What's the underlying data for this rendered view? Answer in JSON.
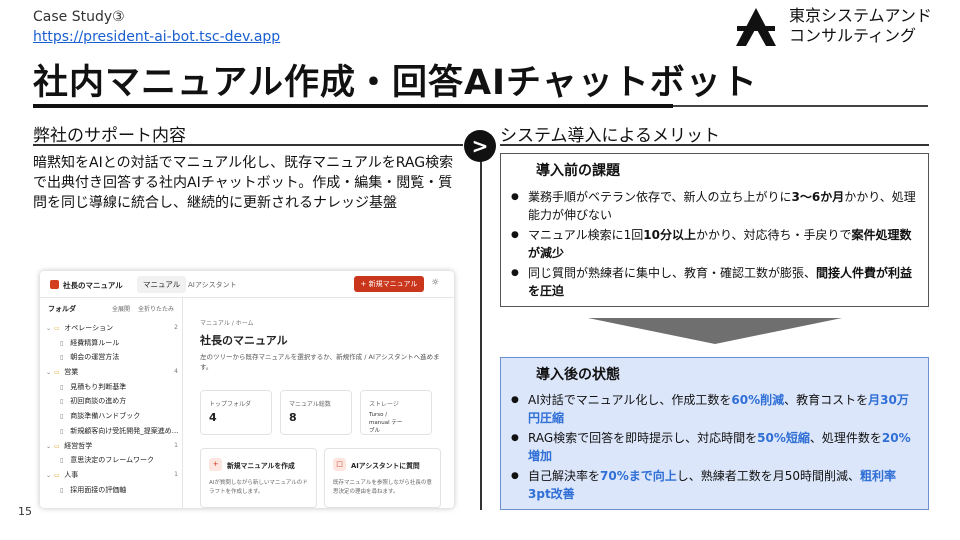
{
  "header": {
    "case_label": "Case Study③",
    "url": "https://president-ai-bot.tsc-dev.app",
    "company_line1": "東京システムアンド",
    "company_line2": "コンサルティング",
    "title": "社内マニュアル作成・回答AIチャットボット"
  },
  "left": {
    "heading": "弊社のサポート内容",
    "body": "暗黙知をAIとの対話でマニュアル化し、既存マニュアルをRAG検索で出典付き回答する社内AIチャットボット。作成・編集・閲覧・質問を同じ導線に統合し、継続的に更新されるナレッジ基盤"
  },
  "right": {
    "heading": "システム導入によるメリット",
    "arrow_glyph": ">",
    "before": {
      "title": "導入前の課題",
      "items": [
        [
          {
            "t": "業務手順がベテラン依存で、新人の立ち上がりに"
          },
          {
            "t": "3〜6か月",
            "s": "hl"
          },
          {
            "t": "かかり、処理能力が伸びない"
          }
        ],
        [
          {
            "t": "マニュアル検索に1回"
          },
          {
            "t": "10分以上",
            "s": "hl"
          },
          {
            "t": "かかり、対応待ち・手戻りで"
          },
          {
            "t": "案件処理数が減少",
            "s": "hl"
          }
        ],
        [
          {
            "t": "同じ質問が熟練者に集中し、教育・確認工数が膨張、"
          },
          {
            "t": "間接人件費が利益を圧迫",
            "s": "hl"
          }
        ]
      ]
    },
    "after": {
      "title": "導入後の状態",
      "items": [
        [
          {
            "t": "AI対話でマニュアル化し、作成工数を"
          },
          {
            "t": "60%削減",
            "s": "bl"
          },
          {
            "t": "、教育コストを"
          },
          {
            "t": "月30万円圧縮",
            "s": "bl"
          }
        ],
        [
          {
            "t": "RAG検索で回答を即時提示し、対応時間を"
          },
          {
            "t": "50%短縮",
            "s": "bl"
          },
          {
            "t": "、処理件数を"
          },
          {
            "t": "20%増加",
            "s": "bl"
          }
        ],
        [
          {
            "t": "自己解決率を"
          },
          {
            "t": "70%まで向上",
            "s": "bl"
          },
          {
            "t": "し、熟練者工数を月50時間削減、"
          },
          {
            "t": "粗利率3pt改善",
            "s": "bl"
          }
        ]
      ]
    }
  },
  "screenshot": {
    "app_name": "社長のマニュアル",
    "tab_manual": "マニュアル",
    "tab_ai": "AIアシスタント",
    "new_button": "+ 新規マニュアル",
    "sidebar_title": "フォルダ",
    "expand_all": "全展開",
    "collapse_all": "全折りたたみ",
    "tree": [
      {
        "type": "folder",
        "label": "オペレーション",
        "count": "2"
      },
      {
        "type": "doc",
        "label": "経費精算ルール"
      },
      {
        "type": "doc",
        "label": "朝会の運営方法"
      },
      {
        "type": "folder",
        "label": "営業",
        "count": "4"
      },
      {
        "type": "doc",
        "label": "見積もり判断基準"
      },
      {
        "type": "doc",
        "label": "初回商談の進め方"
      },
      {
        "type": "doc",
        "label": "商談準備ハンドブック"
      },
      {
        "type": "doc",
        "label": "新規顧客向け受託開発_提案進め..."
      },
      {
        "type": "folder",
        "label": "経営哲学",
        "count": "1"
      },
      {
        "type": "doc",
        "label": "意思決定のフレームワーク"
      },
      {
        "type": "folder",
        "label": "人事",
        "count": "1"
      },
      {
        "type": "doc",
        "label": "採用面接の評価軸"
      }
    ],
    "breadcrumb": "マニュアル / ホーム",
    "main_title": "社長のマニュアル",
    "main_desc": "左のツリーから既存マニュアルを選択するか、新規作成 / AIアシスタントへ進めます。",
    "cards": [
      {
        "label": "トップフォルダ",
        "value": "4"
      },
      {
        "label": "マニュアル総数",
        "value": "8"
      },
      {
        "label": "ストレージ",
        "value": "Turso / manual テーブル"
      }
    ],
    "actions": [
      {
        "icon": "+",
        "title": "新規マニュアルを作成",
        "desc": "AIが質問しながら新しいマニュアルのドラフトを作成します。"
      },
      {
        "icon": "□",
        "title": "AIアシスタントに質問",
        "desc": "既存マニュアルを参照しながら社長の意思決定の理由を尋ねます。"
      }
    ]
  },
  "footer": {
    "page_number": "15"
  }
}
